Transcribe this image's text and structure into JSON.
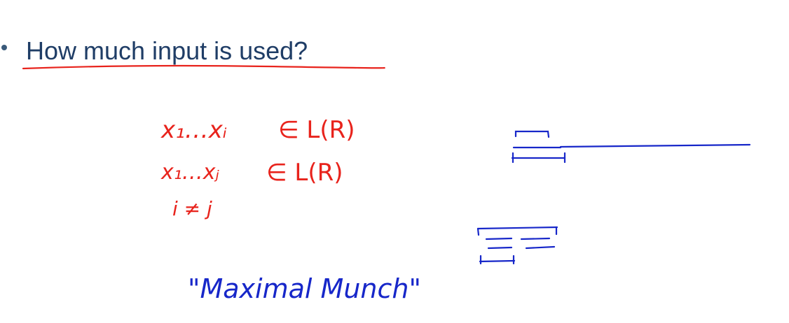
{
  "slide": {
    "bullet": "How much input is used?",
    "colors": {
      "title": "#1f3d66",
      "red_ink": "#e8231c",
      "blue_ink": "#1727c9"
    },
    "annotations": {
      "line1_lhs": "x₁…xᵢ",
      "line1_rhs": "∈  L(R)",
      "line2_lhs": "x₁…xⱼ",
      "line2_rhs": "∈  L(R)",
      "line3": "i ≠ j",
      "quote": "\"Maximal  Munch\""
    }
  }
}
